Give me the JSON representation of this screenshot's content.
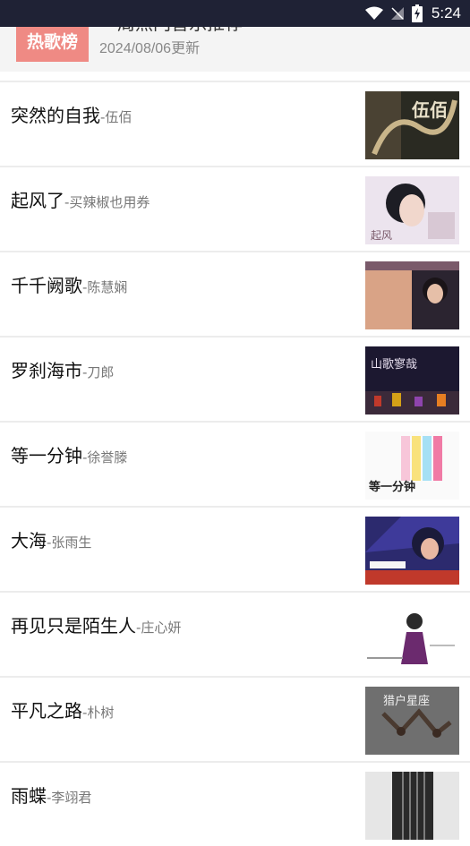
{
  "status_bar": {
    "time": "5:24"
  },
  "header": {
    "badge": "热歌榜",
    "title": "一周热门音乐推荐",
    "updated": "2024/08/06更新"
  },
  "songs": [
    {
      "title": "突然的自我",
      "sep": "-",
      "artist": "伍佰",
      "cover_text": "伍佰"
    },
    {
      "title": "起风了",
      "sep": "-",
      "artist": "买辣椒也用券",
      "cover_text": "起风"
    },
    {
      "title": "千千阙歌",
      "sep": "-",
      "artist": "陈慧娴",
      "cover_text": ""
    },
    {
      "title": "罗刹海市",
      "sep": "-",
      "artist": "刀郎",
      "cover_text": "山歌寥哉"
    },
    {
      "title": "等一分钟",
      "sep": "-",
      "artist": "徐誉滕",
      "cover_text": "等一分钟"
    },
    {
      "title": "大海",
      "sep": "-",
      "artist": "张雨生",
      "cover_text": ""
    },
    {
      "title": "再见只是陌生人",
      "sep": "-",
      "artist": "庄心妍",
      "cover_text": ""
    },
    {
      "title": "平凡之路",
      "sep": "-",
      "artist": "朴树",
      "cover_text": "猎户星座"
    },
    {
      "title": "雨蝶",
      "sep": "-",
      "artist": "李翊君",
      "cover_text": ""
    }
  ],
  "colors": {
    "status_bar": "#1f2235",
    "badge": "#ef8a84",
    "header_bg": "#f4f4f4"
  }
}
